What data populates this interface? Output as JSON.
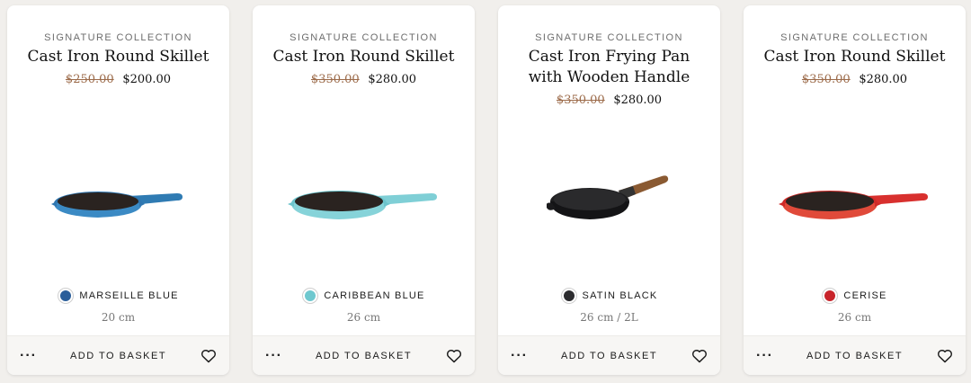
{
  "products": [
    {
      "collection": "SIGNATURE COLLECTION",
      "title": "Cast Iron Round Skillet",
      "old_price": "$250.00",
      "new_price": "$200.00",
      "color_name": "MARSEILLE BLUE",
      "color_hex": "#2a5e9a",
      "size": "20 cm",
      "more_label": "···",
      "add_to_basket": "ADD TO BASKET"
    },
    {
      "collection": "SIGNATURE COLLECTION",
      "title": "Cast Iron Round Skillet",
      "old_price": "$350.00",
      "new_price": "$280.00",
      "color_name": "CARIBBEAN BLUE",
      "color_hex": "#6fc8cf",
      "size": "26 cm",
      "more_label": "···",
      "add_to_basket": "ADD TO BASKET"
    },
    {
      "collection": "SIGNATURE COLLECTION",
      "title": "Cast Iron Frying Pan with Wooden Handle",
      "old_price": "$350.00",
      "new_price": "$280.00",
      "color_name": "SATIN BLACK",
      "color_hex": "#2b2b2e",
      "size": "26 cm / 2L",
      "more_label": "···",
      "add_to_basket": "ADD TO BASKET"
    },
    {
      "collection": "SIGNATURE COLLECTION",
      "title": "Cast Iron Round Skillet",
      "old_price": "$350.00",
      "new_price": "$280.00",
      "color_name": "CERISE",
      "color_hex": "#c8242b",
      "size": "26 cm",
      "more_label": "···",
      "add_to_basket": "ADD TO BASKET"
    }
  ],
  "icons": {
    "more": "more-options-icon",
    "heart": "heart-outline-icon"
  }
}
